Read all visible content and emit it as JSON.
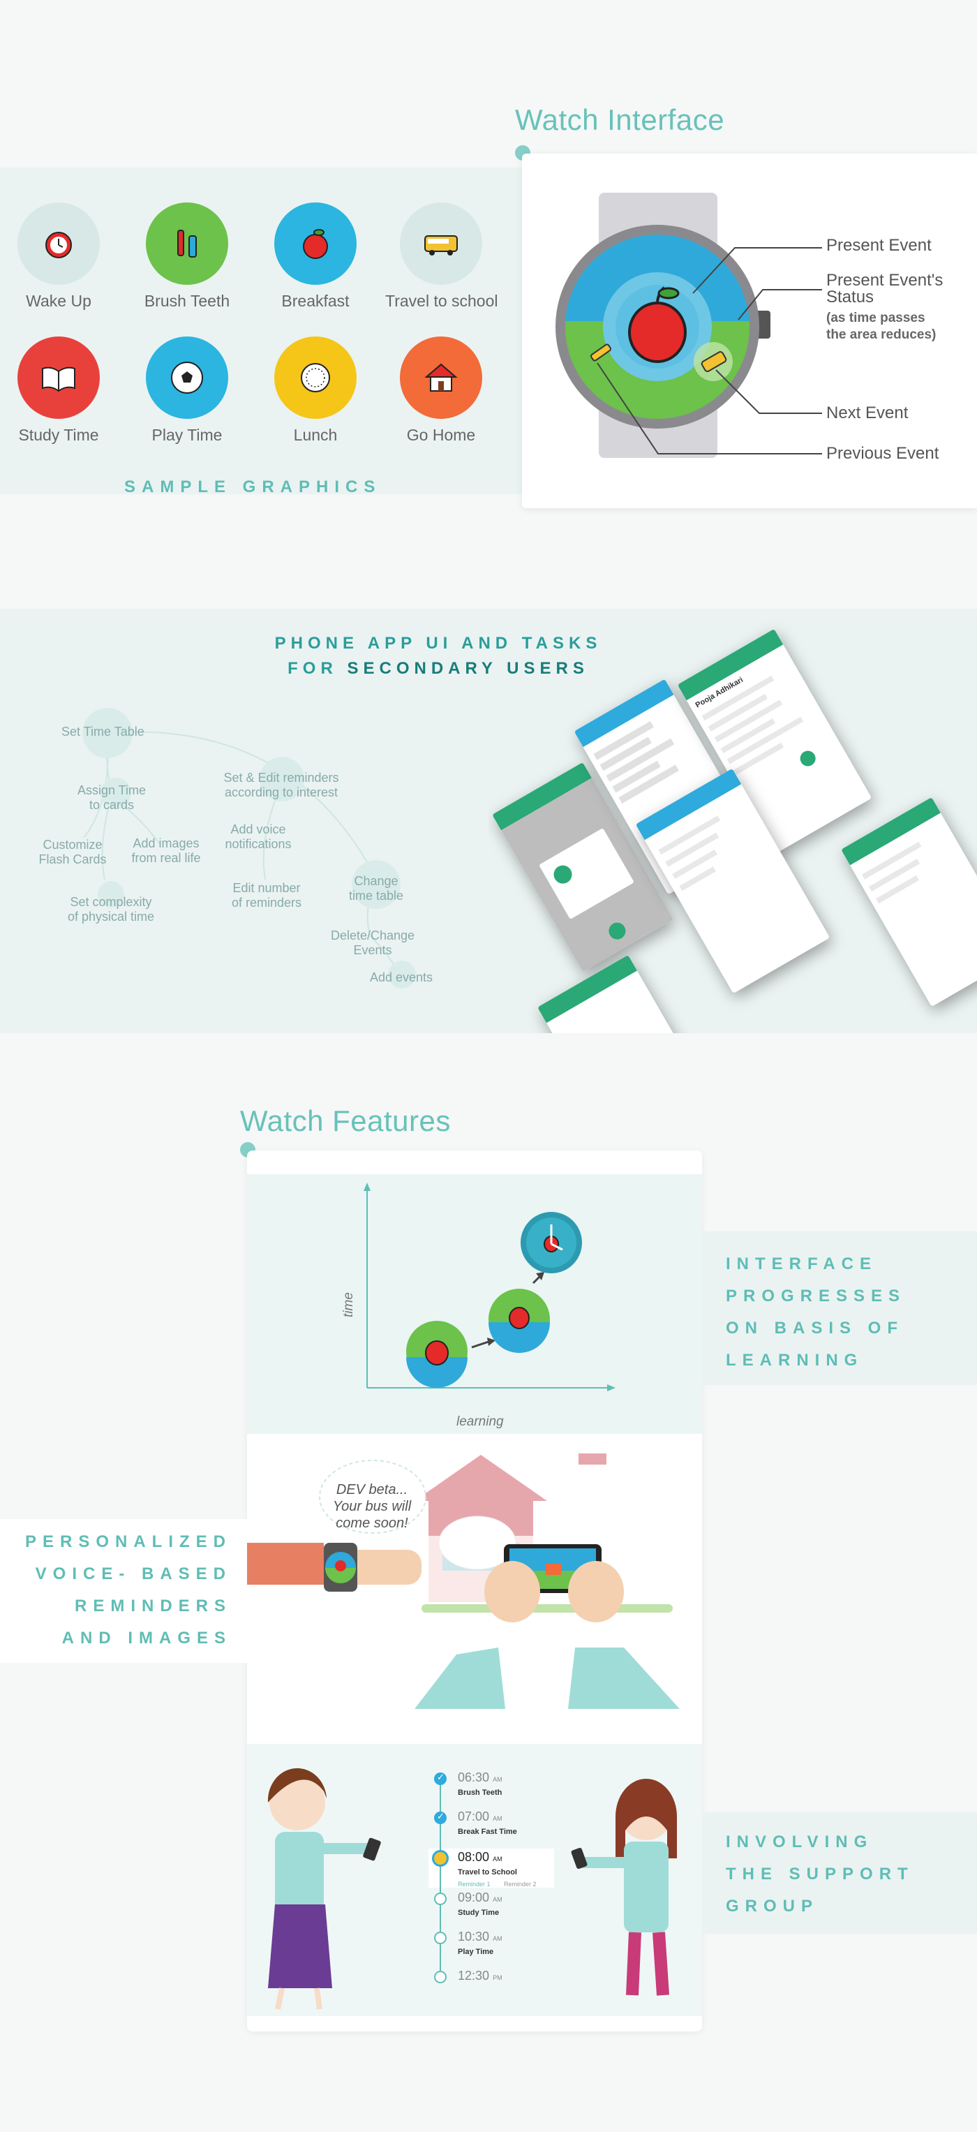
{
  "watch_interface": {
    "title": "Watch Interface",
    "callouts": {
      "present_event": "Present Event",
      "present_status_line1": "Present Event's",
      "present_status_line2": "Status",
      "status_note_line1": "(as time passes",
      "status_note_line2": "the area reduces)",
      "next_event": "Next Event",
      "previous_event": "Previous Event"
    }
  },
  "sample_graphics": {
    "caption": "SAMPLE GRAPHICS",
    "items": [
      {
        "label": "Wake Up",
        "icon": "alarm-clock-icon",
        "color": "#d8e8e6"
      },
      {
        "label": "Brush Teeth",
        "icon": "toothbrush-icon",
        "color": "#6cc24a"
      },
      {
        "label": "Breakfast",
        "icon": "apple-icon",
        "color": "#2bb5e0"
      },
      {
        "label": "Travel to school",
        "icon": "school-bus-icon",
        "color": "#d8e8e6"
      },
      {
        "label": "Study Time",
        "icon": "book-icon",
        "color": "#e8413c"
      },
      {
        "label": "Play Time",
        "icon": "soccer-ball-icon",
        "color": "#2bb5e0"
      },
      {
        "label": "Lunch",
        "icon": "plate-icon",
        "color": "#f5c518"
      },
      {
        "label": "Go Home",
        "icon": "house-icon",
        "color": "#f26b38"
      }
    ]
  },
  "phone_app": {
    "title_line1": "PHONE APP UI AND TASKS",
    "title_line2_prefix": "FOR ",
    "title_line2_bold": "SECONDARY USERS",
    "mindmap": {
      "set_time_table": "Set Time Table",
      "assign_time_1": "Assign Time",
      "assign_time_2": "to cards",
      "customize_1": "Customize",
      "customize_2": "Flash Cards",
      "add_images_1": "Add images",
      "add_images_2": "from real life",
      "complexity_1": "Set complexity",
      "complexity_2": "of physical time",
      "set_edit_1": "Set & Edit reminders",
      "set_edit_2": "according to interest",
      "voice_1": "Add voice",
      "voice_2": "notifications",
      "edit_num_1": "Edit number",
      "edit_num_2": "of reminders",
      "change_1": "Change",
      "change_2": "time table",
      "delete_1": "Delete/Change",
      "delete_2": "Events",
      "add_events": "Add events"
    },
    "phone_header": "Pooja Adhikari"
  },
  "watch_features": {
    "title": "Watch Features",
    "graph": {
      "ylabel": "time",
      "xlabel": "learning"
    },
    "interface_label": [
      "INTERFACE",
      "PROGRESSES",
      "ON BASIS OF",
      "LEARNING"
    ],
    "personalized_label": [
      "PERSONALIZED",
      "VOICE- BASED",
      "REMINDERS",
      "AND IMAGES"
    ],
    "support_label": [
      "INVOLVING",
      "THE SUPPORT",
      "GROUP"
    ],
    "speech": [
      "DEV beta...",
      "Your bus will",
      "come soon!"
    ],
    "timeline": [
      {
        "time": "06:30",
        "ampm": "AM",
        "event": "Brush Teeth",
        "done": true
      },
      {
        "time": "07:00",
        "ampm": "AM",
        "event": "Break Fast Time",
        "done": true
      },
      {
        "time": "08:00",
        "ampm": "AM",
        "event": "Travel to School",
        "done": false,
        "current": true
      },
      {
        "time": "09:00",
        "ampm": "AM",
        "event": "Study Time",
        "done": false
      },
      {
        "time": "10:30",
        "ampm": "AM",
        "event": "Play Time",
        "done": false
      },
      {
        "time": "12:30",
        "ampm": "PM",
        "event": "",
        "done": false
      }
    ],
    "reminders": {
      "r1": "Reminder 1",
      "r2": "Reminder 2"
    }
  }
}
